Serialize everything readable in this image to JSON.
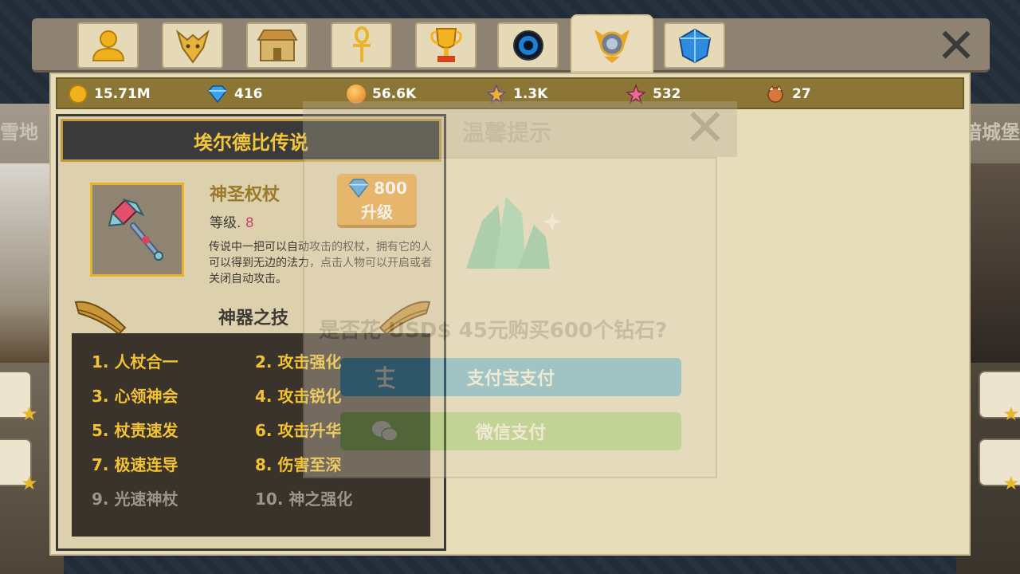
{
  "background": {
    "left_label": "雪地",
    "right_label": "暗城堡"
  },
  "tabs": [
    {
      "icon": "user-icon"
    },
    {
      "icon": "dragon-head-icon"
    },
    {
      "icon": "shop-icon"
    },
    {
      "icon": "ankh-icon"
    },
    {
      "icon": "trophy-icon"
    },
    {
      "icon": "orb-icon"
    },
    {
      "icon": "artifact-emblem-icon",
      "active": true
    },
    {
      "icon": "blue-gem-icon"
    }
  ],
  "resources": [
    {
      "icon": "gold-coin-icon",
      "value": "15.71M"
    },
    {
      "icon": "diamond-icon",
      "value": "416"
    },
    {
      "icon": "orange-orb-icon",
      "value": "56.6K"
    },
    {
      "icon": "gold-rune-icon",
      "value": "1.3K"
    },
    {
      "icon": "pink-rune-icon",
      "value": "532"
    },
    {
      "icon": "beast-token-icon",
      "value": "27"
    }
  ],
  "card": {
    "title": "埃尔德比传说",
    "item_name": "神圣权杖",
    "level_label": "等级.",
    "level_value": "8",
    "description": "传说中一把可以自动攻击的权杖，拥有它的人可以得到无边的法力，点击人物可以开启或者关闭自动攻击。",
    "upgrade_cost": "800",
    "upgrade_label": "升级",
    "skills_title": "神器之技",
    "skills": [
      {
        "label": "1. 人杖合一",
        "unlocked": true
      },
      {
        "label": "2. 攻击强化",
        "unlocked": true
      },
      {
        "label": "3. 心领神会",
        "unlocked": true
      },
      {
        "label": "4. 攻击锐化",
        "unlocked": true
      },
      {
        "label": "5. 杖责速发",
        "unlocked": true
      },
      {
        "label": "6. 攻击升华",
        "unlocked": true
      },
      {
        "label": "7. 极速连导",
        "unlocked": true
      },
      {
        "label": "8. 伤害至深",
        "unlocked": true
      },
      {
        "label": "9. 光速神杖",
        "unlocked": false
      },
      {
        "label": "10. 神之强化",
        "unlocked": false
      }
    ]
  },
  "dialog": {
    "title": "温馨提示",
    "message": "是否花 USD$ 45元购买600个钻石?",
    "alipay_label": "支付宝支付",
    "wechat_label": "微信支付"
  },
  "colors": {
    "accent_gold": "#f3c233",
    "resource_bar": "#8b7635",
    "upgrade_button": "#e9a640",
    "alipay": "#1e97d2",
    "wechat": "#7ec44f"
  }
}
